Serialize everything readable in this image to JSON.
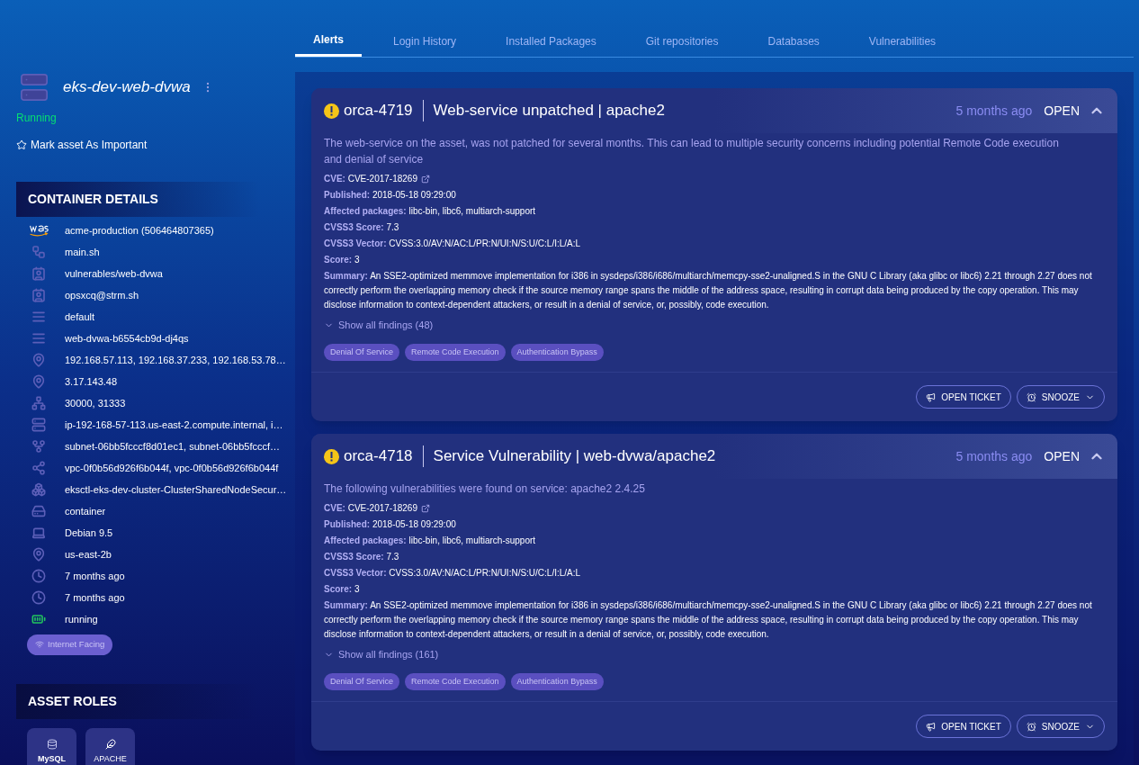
{
  "tabs": [
    {
      "label": "Alerts",
      "selected": true
    },
    {
      "label": "Login History",
      "selected": false
    },
    {
      "label": "Installed Packages",
      "selected": false
    },
    {
      "label": "Git repositories",
      "selected": false
    },
    {
      "label": "Databases",
      "selected": false
    },
    {
      "label": "Vulnerabilities",
      "selected": false
    }
  ],
  "asset": {
    "name": "eks-dev-web-dvwa",
    "status": "Running",
    "mark_important": "Mark asset As Important"
  },
  "container_details": {
    "title": "CONTAINER DETAILS",
    "items": [
      {
        "value": "acme-production (506464807365)"
      },
      {
        "value": "main.sh"
      },
      {
        "value": "vulnerables/web-dvwa"
      },
      {
        "value": "opsxcq@strm.sh"
      },
      {
        "value": "default"
      },
      {
        "value": "web-dvwa-b6554cb9d-dj4qs"
      },
      {
        "value": "192.168.57.113, 192.168.37.233, 192.168.53.78…"
      },
      {
        "value": "3.17.143.48"
      },
      {
        "value": "30000, 31333"
      },
      {
        "value": "ip-192-168-57-113.us-east-2.compute.internal, i…"
      },
      {
        "value": "subnet-06bb5fcccf8d01ec1, subnet-06bb5fcccf…"
      },
      {
        "value": "vpc-0f0b56d926f6b044f, vpc-0f0b56d926f6b044f"
      },
      {
        "value": "eksctl-eks-dev-cluster-ClusterSharedNodeSecur…"
      },
      {
        "value": "container"
      },
      {
        "value": "Debian  9.5"
      },
      {
        "value": "us-east-2b"
      },
      {
        "value": "7 months ago"
      },
      {
        "value": "7 months ago"
      },
      {
        "value": "running"
      }
    ],
    "tag": "Internet Facing"
  },
  "asset_roles": {
    "title": "ASSET ROLES",
    "roles": [
      "MySQL",
      "APACHE"
    ]
  },
  "alerts": [
    {
      "id": "orca-4719",
      "title": "Web-service unpatched | apache2",
      "time": "5 months ago",
      "state": "OPEN",
      "expanded": true,
      "description": "The web-service on the asset, was not patched for several months. This can lead to multiple security concerns including potential Remote Code execution and denial of service",
      "fields": [
        {
          "label": "CVE:",
          "value": "CVE-2017-18269",
          "link": true
        },
        {
          "label": "Published:",
          "value": "2018-05-18 09:29:00"
        },
        {
          "label": "Affected packages:",
          "value": "libc-bin, libc6, multiarch-support"
        },
        {
          "label": "CVSS3 Score:",
          "value": "7.3"
        },
        {
          "label": "CVSS3 Vector:",
          "value": "CVSS:3.0/AV:N/AC:L/PR:N/UI:N/S:U/C:L/I:L/A:L"
        },
        {
          "label": "Score:",
          "value": "3"
        },
        {
          "label": "Summary:",
          "value": "An SSE2-optimized memmove implementation for i386 in sysdeps/i386/i686/multiarch/memcpy-sse2-unaligned.S in the GNU C Library (aka glibc or libc6) 2.21 through 2.27 does not correctly perform the overlapping memory check if the source memory range spans the middle of the address space, resulting in corrupt data being produced by the copy operation. This may disclose information to context-dependent attackers, or result in a denial of service, or, possibly, code execution."
        }
      ],
      "show_all": "Show all findings (48)",
      "tags": [
        "Denial Of Service",
        "Remote Code Execution",
        "Authentication Bypass"
      ],
      "actions": [
        "OPEN TICKET",
        "SNOOZE"
      ]
    },
    {
      "id": "orca-4718",
      "title": "Service Vulnerability | web-dvwa/apache2",
      "time": "5 months ago",
      "state": "OPEN",
      "expanded": true,
      "description": "The following vulnerabilities were found on service: apache2 2.4.25",
      "fields": [
        {
          "label": "CVE:",
          "value": "CVE-2017-18269",
          "link": true
        },
        {
          "label": "Published:",
          "value": "2018-05-18 09:29:00"
        },
        {
          "label": "Affected packages:",
          "value": "libc-bin, libc6, multiarch-support"
        },
        {
          "label": "CVSS3 Score:",
          "value": "7.3"
        },
        {
          "label": "CVSS3 Vector:",
          "value": "CVSS:3.0/AV:N/AC:L/PR:N/UI:N/S:U/C:L/I:L/A:L"
        },
        {
          "label": "Score:",
          "value": "3"
        },
        {
          "label": "Summary:",
          "value": "An SSE2-optimized memmove implementation for i386 in sysdeps/i386/i686/multiarch/memcpy-sse2-unaligned.S in the GNU C Library (aka glibc or libc6) 2.21 through 2.27 does not correctly perform the overlapping memory check if the source memory range spans the middle of the address space, resulting in corrupt data being produced by the copy operation. This may disclose information to context-dependent attackers, or result in a denial of service, or, possibly, code execution."
        }
      ],
      "show_all": "Show all findings (161)",
      "tags": [
        "Denial Of Service",
        "Remote Code Execution",
        "Authentication Bypass"
      ],
      "actions": [
        "OPEN TICKET",
        "SNOOZE"
      ]
    }
  ]
}
